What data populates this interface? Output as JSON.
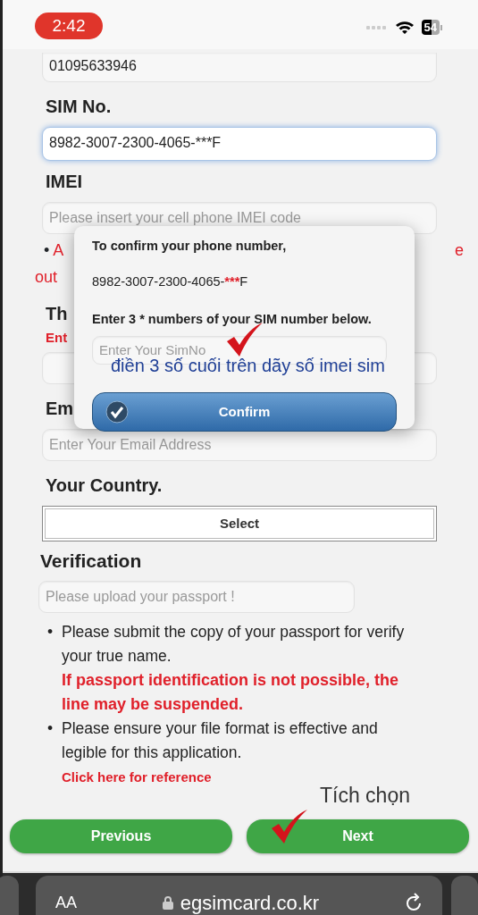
{
  "status_bar": {
    "time": "2:42",
    "battery": "54"
  },
  "form": {
    "phone_field": {
      "value": "01095633946"
    },
    "sim": {
      "label": "SIM No.",
      "value": "8982-3007-2300-4065-***F",
      "focused": true
    },
    "imei": {
      "label": "IMEI",
      "placeholder": "Please insert your cell phone IMEI code"
    },
    "imei_note": {
      "bullet": "•",
      "start": "A",
      "end": "e",
      "next_line": "out"
    },
    "section_3": {
      "label": "Th",
      "note": "Ent"
    },
    "email": {
      "label": "Em",
      "placeholder": "Enter Your Email Address"
    },
    "country": {
      "label": "Your Country.",
      "button": "Select"
    },
    "verification": {
      "title": "Verification",
      "placeholder": "Please upload your passport !",
      "notes": [
        {
          "bullet": "•",
          "text": "Please submit the copy of your passport for verify your true name.",
          "warning": "If passport identification is not possible, the line may be suspended."
        },
        {
          "bullet": "•",
          "text": "Please ensure your file format is effective and legible for this application.",
          "link": "Click here for reference"
        }
      ]
    }
  },
  "dialog": {
    "title": "To confirm your phone number,",
    "sim_prefix": "8982-3007-2300-4065-",
    "sim_mask": "***",
    "sim_suffix": "F",
    "instruction": "Enter 3 * numbers of your SIM number below.",
    "placeholder": "Enter Your SimNo",
    "button": "Confirm"
  },
  "nav_buttons": [
    {
      "label": "Previous"
    },
    {
      "label": "Next"
    }
  ],
  "browser_bar": {
    "text_size": "AA",
    "url": "egsimcard.co.kr"
  },
  "annotations": [
    {
      "kind": "dialog-hint",
      "text": "điền 3 số cuối trên dãy số imei sim"
    },
    {
      "kind": "next-hint",
      "text": "Tích chọn"
    }
  ]
}
